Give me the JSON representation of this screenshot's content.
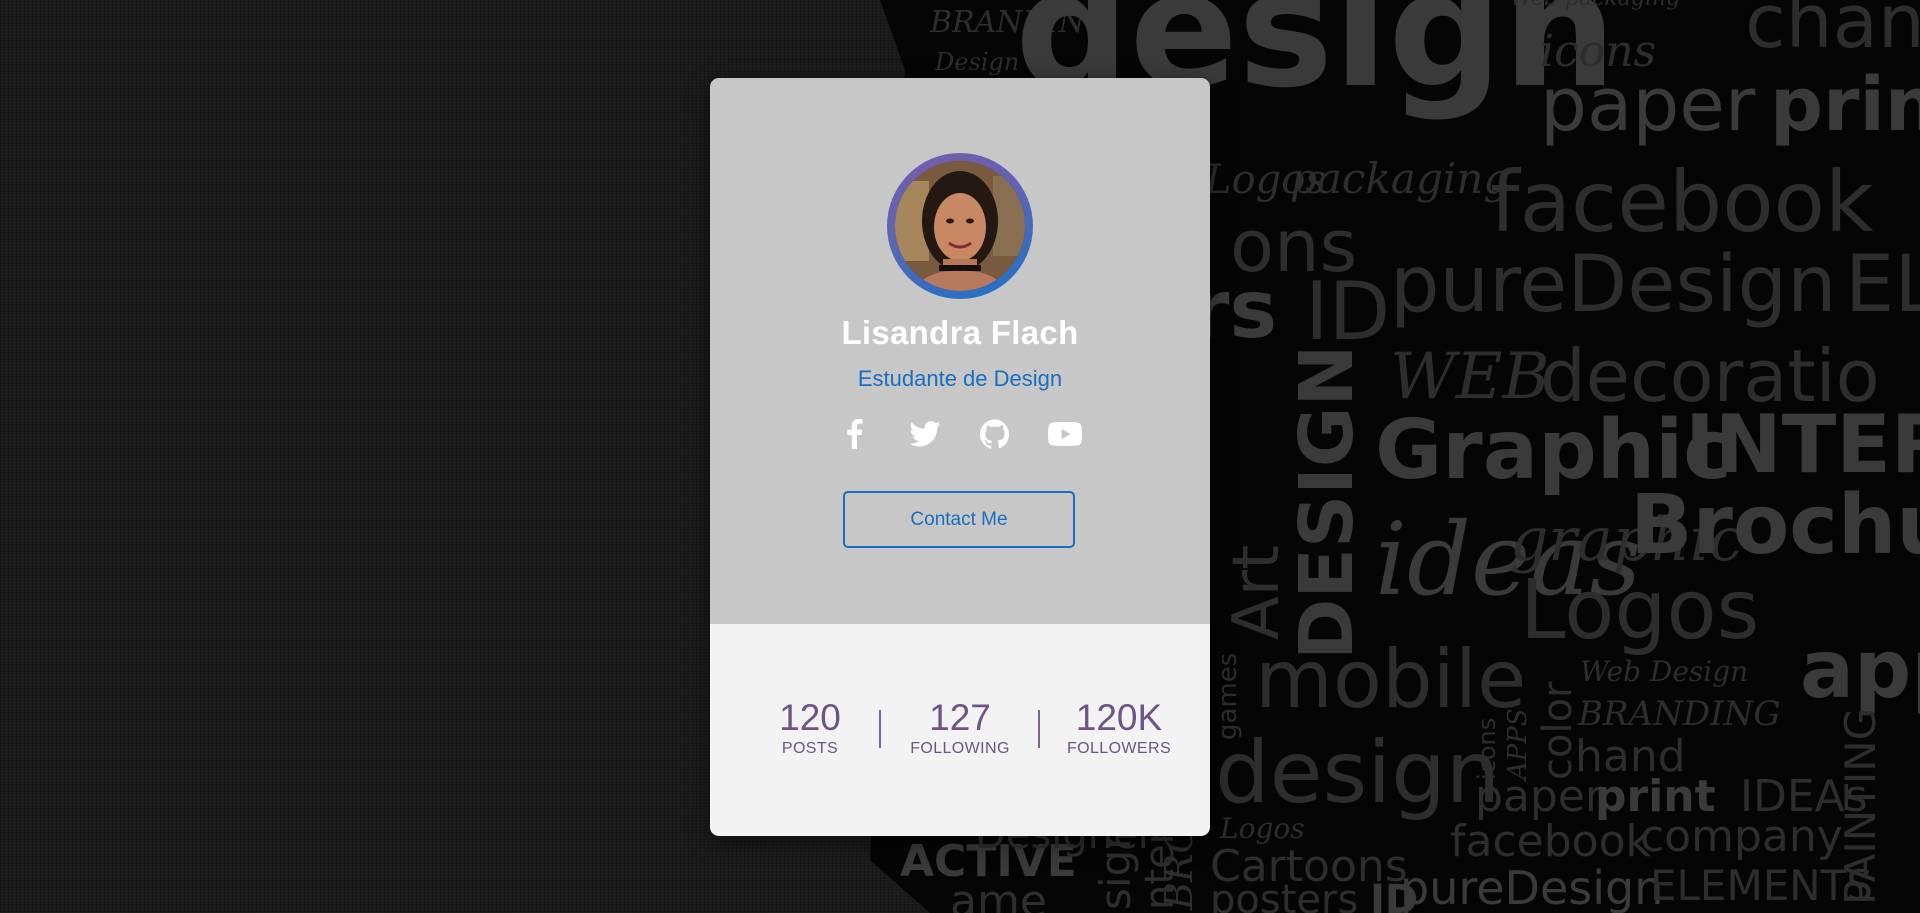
{
  "background": {
    "words": [
      "BRANDING",
      "Design",
      "design",
      "icons",
      "chand",
      "paper",
      "prin",
      "Logos",
      "packaging",
      "facebook",
      "ons",
      "rs",
      "ID",
      "pureDesign",
      "EL",
      "WEB",
      "decoratio",
      "DESIGN",
      "Graphic",
      "INTERA",
      "Art",
      "ideas",
      "graphic",
      "Brochures",
      "Logos",
      "mobile",
      "app",
      "games",
      "Web Design",
      "BRANDING",
      "color",
      "hand",
      "icons",
      "APPS",
      "design",
      "paper",
      "print",
      "IDEAs",
      "PAINTING",
      "Logos",
      "facebook",
      "company",
      "ACTIVE",
      "Designer",
      "Cartoons",
      "posters",
      "ID",
      "pureDesign",
      "ELEMENTS",
      "ame",
      "signer",
      "nter",
      "BROC",
      "Web packaging"
    ]
  },
  "profile": {
    "name": "Lisandra Flach",
    "subtitle": "Estudante de Design",
    "contact_label": "Contact Me",
    "accent_color": "#1a6ec2",
    "stat_color": "#6c5488"
  },
  "socials": [
    {
      "icon": "facebook-icon"
    },
    {
      "icon": "twitter-icon"
    },
    {
      "icon": "github-icon"
    },
    {
      "icon": "youtube-icon"
    }
  ],
  "stats": [
    {
      "value": "120",
      "label": "POSTS"
    },
    {
      "value": "127",
      "label": "FOLLOWING"
    },
    {
      "value": "120K",
      "label": "FOLLOWERS"
    }
  ]
}
